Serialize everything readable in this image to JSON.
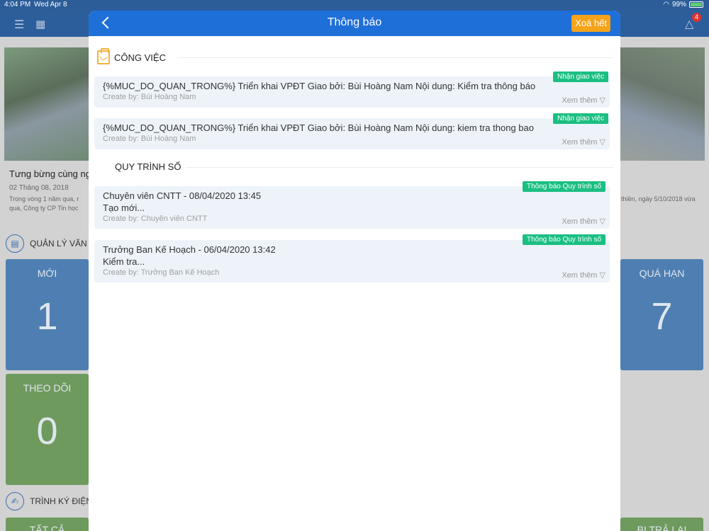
{
  "status_bar": {
    "time": "4:04 PM",
    "date": "Wed Apr 8",
    "battery": "99%"
  },
  "background": {
    "notification_count": "4",
    "headline": "Tưng bừng cùng ng",
    "date": "02 Tháng 08, 2018",
    "desc_left_1": "Trong vòng 1 năm qua, r",
    "desc_left_2": "qua, Công ty CP Tin học",
    "desc_right_1": "thiền, ngày 5/10/2018 vừa",
    "section1": "QUẢN LÝ VĂN",
    "section2": "TRÌNH KÝ ĐIỆN",
    "tiles": [
      {
        "label": "MỚI",
        "value": "1"
      },
      {
        "label": "QUÁ HẠN",
        "value": "7"
      },
      {
        "label": "THEO DÕI",
        "value": "0"
      },
      {
        "label": "TẤT CẢ",
        "value": ""
      },
      {
        "label": "BỊ TRẢ LẠI",
        "value": ""
      }
    ]
  },
  "modal": {
    "title": "Thông báo",
    "clear_label": "Xoá hết",
    "sections": [
      {
        "title": "CÔNG VIỆC",
        "items": [
          {
            "tag": "Nhận giao việc",
            "text": "{%MUC_DO_QUAN_TRONG%} Triển khai VPĐT  Giao bởi:  Bùi Hoàng Nam    Nội dung: Kiểm tra thông báo",
            "creator": "Create by: Bùi Hoàng Nam",
            "more": "Xem thêm ▽"
          },
          {
            "tag": "Nhận giao việc",
            "text": "{%MUC_DO_QUAN_TRONG%} Triển khai VPĐT  Giao bởi:  Bùi Hoàng Nam    Nội dung: kiem tra thong bao",
            "creator": "Create by: Bùi Hoàng Nam",
            "more": "Xem thêm ▽"
          }
        ]
      },
      {
        "title": "QUY TRÌNH SỐ",
        "items": [
          {
            "tag": "Thông báo Quy trình số",
            "text": "Chuyên viên CNTT - 08/04/2020 13:45",
            "detail": "Tạo mới...",
            "creator": "Create by: Chuyên viên CNTT",
            "more": "Xem thêm ▽"
          },
          {
            "tag": "Thông báo Quy trình số",
            "text": "Trưởng Ban Kế Hoạch - 06/04/2020 13:42",
            "detail": "Kiểm tra...",
            "creator": "Create by: Trưởng Ban Kế Hoạch",
            "more": "Xem thêm ▽"
          }
        ]
      }
    ]
  }
}
